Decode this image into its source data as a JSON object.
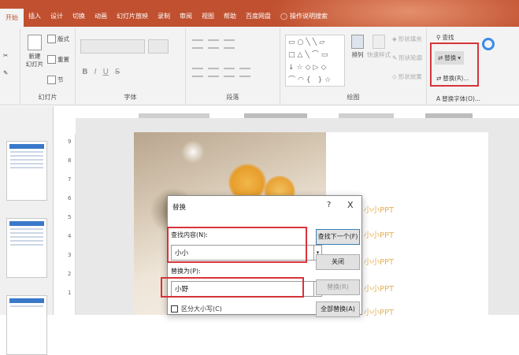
{
  "tabs": [
    "开始",
    "插入",
    "设计",
    "切换",
    "动画",
    "幻灯片放映",
    "录制",
    "审阅",
    "视图",
    "帮助",
    "百度网盘"
  ],
  "tell_me": "操作说明搜索",
  "ribbon": {
    "slides_group": {
      "label": "幻灯片",
      "new_slide": "新建\n幻灯片",
      "layout": "版式",
      "reset": "重置",
      "section": "节"
    },
    "font_group": {
      "label": "字体",
      "bold": "B",
      "italic": "I",
      "underline": "U",
      "strike": "S"
    },
    "paragraph_group": {
      "label": "段落"
    },
    "drawing_group": {
      "label": "绘图",
      "arrange": "排列",
      "quick_styles": "快速样式",
      "shape_fill": "形状填充",
      "shape_outline": "形状轮廓",
      "shape_effects": "形状效果"
    },
    "editing_group": {
      "find": "查找",
      "replace": "替换",
      "replace_menu_item": "替换(R)...",
      "replace_fonts": "替换字体(O)..."
    }
  },
  "ruler_numbers": [
    "9",
    "8",
    "7",
    "6",
    "5",
    "4",
    "3",
    "2",
    "1"
  ],
  "slide_text": [
    "小小PPT",
    "小小PPT",
    "小小PPT",
    "小小PPT",
    "小小PPT"
  ],
  "dialog": {
    "title": "替换",
    "help": "?",
    "close": "X",
    "find_label": "查找内容(N):",
    "find_value": "小小",
    "replace_label": "替换为(P):",
    "replace_value": "小野",
    "find_next": "查找下一个(F)",
    "close_btn": "关闭",
    "replace_btn": "替换(R)",
    "replace_all": "全部替换(A)",
    "match_case": "区分大小写(C)"
  },
  "colors": {
    "accent": "#c0502f",
    "highlight": "#d8333a",
    "ppt_text": "#e3b15b"
  }
}
